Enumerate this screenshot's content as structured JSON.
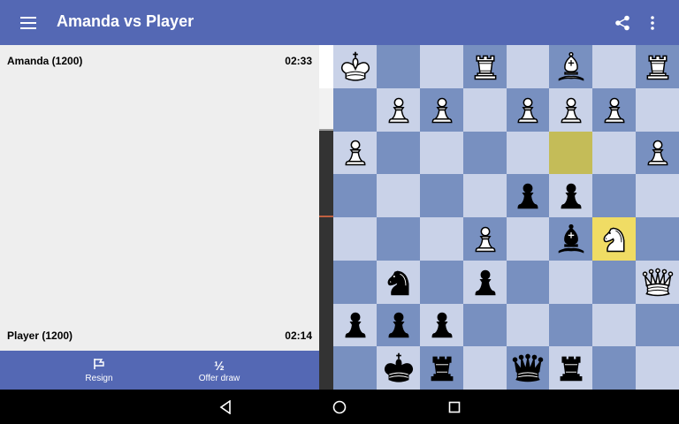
{
  "app": {
    "title": "Amanda vs Player",
    "bar_color": "#5468b4"
  },
  "icons": {
    "menu": "hamburger-menu-icon",
    "share": "share-icon",
    "more": "more-vert-icon",
    "resign": "flag-icon",
    "draw": "half-icon"
  },
  "opponent": {
    "name": "Amanda (1200)",
    "clock": "02:33"
  },
  "player": {
    "name": "Player (1200)",
    "clock": "02:14"
  },
  "actions": {
    "resign_label": "Resign",
    "draw_icon_text": "½",
    "draw_label": "Offer draw"
  },
  "board": {
    "colors": {
      "light": "#c9d2e8",
      "dark": "#7890c0",
      "highlight_empty": "#c4bc58",
      "highlight_piece": "#f0dc64"
    },
    "ranks": [
      [
        "white-king",
        "",
        "",
        "white-rook",
        "",
        "white-bishop",
        "",
        "white-rook"
      ],
      [
        "",
        "white-pawn",
        "white-pawn",
        "",
        "white-pawn",
        "white-pawn",
        "white-pawn",
        ""
      ],
      [
        "white-pawn",
        "",
        "",
        "",
        "",
        "",
        "",
        "white-pawn"
      ],
      [
        "",
        "",
        "",
        "",
        "black-pawn",
        "black-pawn",
        "",
        ""
      ],
      [
        "",
        "",
        "",
        "white-pawn",
        "",
        "black-bishop",
        "white-knight",
        ""
      ],
      [
        "",
        "black-knight",
        "",
        "black-pawn",
        "",
        "",
        "",
        "white-queen"
      ],
      [
        "black-pawn",
        "black-pawn",
        "black-pawn",
        "",
        "",
        "",
        "",
        ""
      ],
      [
        "",
        "black-king",
        "black-rook",
        "",
        "black-queen",
        "black-rook",
        "",
        ""
      ]
    ],
    "highlights": [
      {
        "row": 2,
        "col": 5,
        "kind": "highlight_empty"
      },
      {
        "row": 4,
        "col": 6,
        "kind": "highlight_piece"
      }
    ]
  },
  "navigation": {
    "back": "back-triangle-icon",
    "home": "home-circle-icon",
    "recents": "recents-square-icon"
  }
}
